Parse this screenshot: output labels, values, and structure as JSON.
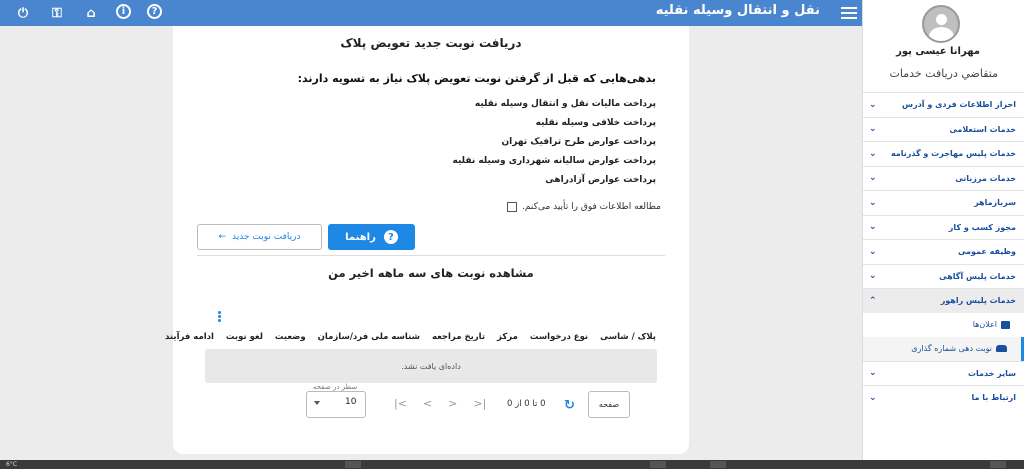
{
  "header": {
    "title": "نقل و انتقال وسيله نقليه",
    "icons": [
      "power-icon",
      "key-icon",
      "home-icon",
      "info-icon",
      "help-icon"
    ]
  },
  "card": {
    "title": "دریافت نوبت جدید تعویض پلاک",
    "debts_title": "بدهی‌هایی که قبل از گرفتن نوبت تعویض پلاک نیاز به تسویه دارند:",
    "debts": [
      "پرداخت مالیات نقل و انتقال وسیله نقلیه",
      "پرداخت خلافی وسیله نقلیه",
      "پرداخت عوارض طرح ترافیک تهران",
      "پرداخت عوارض سالیانه شهرداری وسیله نقلیه",
      "پرداخت عوارض آزادراهی"
    ],
    "confirm_label": "مطالعه اطلاعات فوق را تأیید می‌کنم.",
    "help_button": "راهنما",
    "new_button": "دریافت نوبت جدید",
    "section_title": "مشاهده نوبت های سه ماهه اخیر من",
    "columns": [
      "پلاک / شاسی",
      "نوع درخواست",
      "مرکز",
      "تاریخ مراجعه",
      "شناسه ملی فرد/سازمان",
      "وضعیت",
      "لغو نوبت",
      "ادامه فرآیند"
    ],
    "no_data": "داده‌ای یافت نشد.",
    "pager": {
      "per_page_label": "سطر در صفحه",
      "per_page_value": "10",
      "range": "0 تا 0 از 0",
      "page_label": "صفحه"
    }
  },
  "sidebar": {
    "user_name": "مهرانا عیسی پور",
    "user_role": "متقاضي دريافت خدمات",
    "items": [
      {
        "label": "احراز اطلاعات فردی و آدرس"
      },
      {
        "label": "خدمات استعلامی"
      },
      {
        "label": "خدمات پلیس مهاجرت و گذرنامه"
      },
      {
        "label": "خدمات مرزبانی"
      },
      {
        "label": "سربازماهر"
      },
      {
        "label": "مجوز کسب و کار"
      },
      {
        "label": "وظیفه عمومی"
      },
      {
        "label": "خدمات پلیس آگاهی"
      },
      {
        "label": "خدمات پلیس راهور"
      }
    ],
    "sub_items": [
      {
        "label": "اعلان‌ها"
      },
      {
        "label": "نوبت دهی شماره گذاری"
      }
    ],
    "bottom_items": [
      {
        "label": "سایر خدمات"
      },
      {
        "label": "ارتباط با ما"
      }
    ]
  },
  "taskbar": {
    "label": "6°C"
  }
}
